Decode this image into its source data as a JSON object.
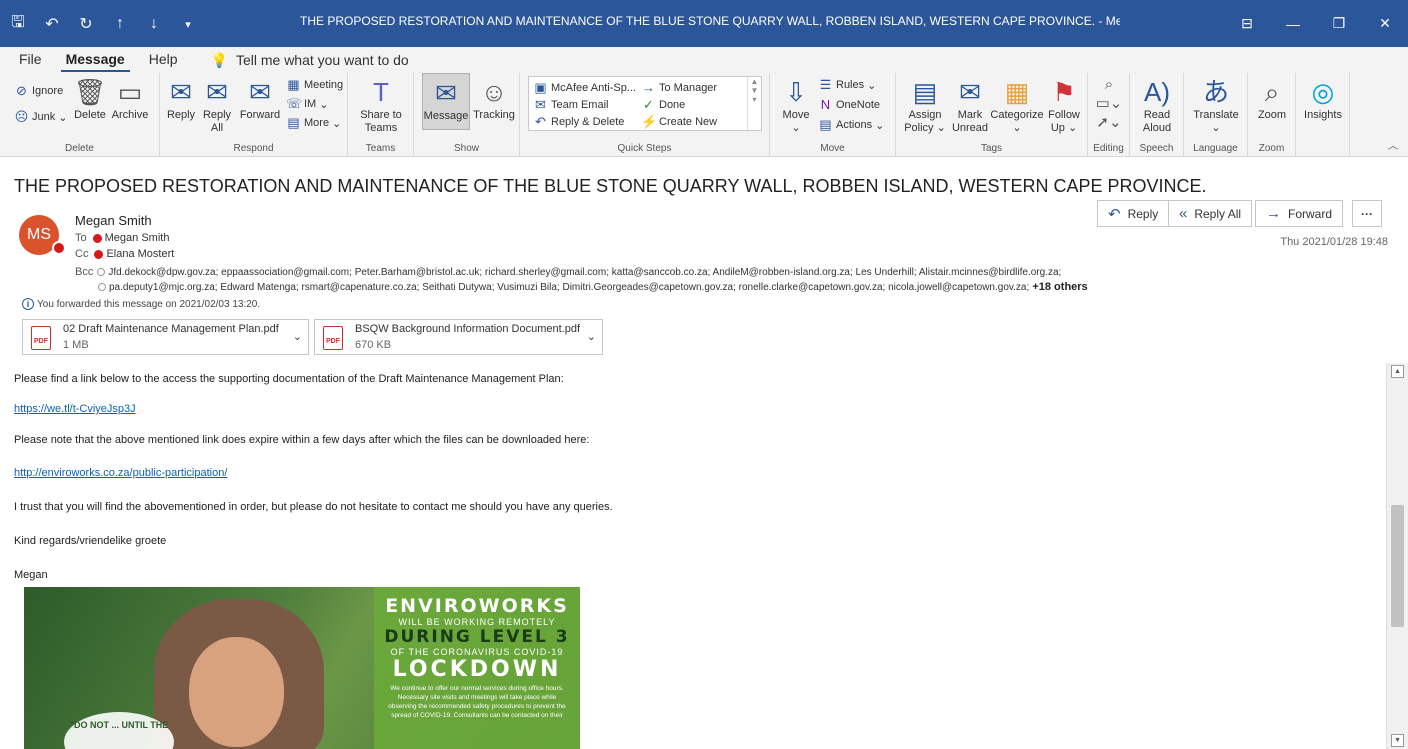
{
  "window": {
    "title": "THE PROPOSED RESTORATION AND MAINTENANCE OF THE BLUE STONE QUARRY WALL, ROBBEN ISLAND, WESTERN CAPE PROVINCE.  - Message (HTML)",
    "accent": "#2b579a"
  },
  "menu": {
    "items": [
      "File",
      "Message",
      "Help"
    ],
    "active": "Message",
    "search": "Tell me what you want to do"
  },
  "ribbon": {
    "delete": {
      "ignore": "Ignore",
      "junk": "Junk",
      "delete": "Delete",
      "archive": "Archive",
      "label": "Delete"
    },
    "respond": {
      "reply": "Reply",
      "reply_all_1": "Reply",
      "reply_all_2": "All",
      "forward": "Forward",
      "meeting": "Meeting",
      "im": "IM",
      "more": "More",
      "label": "Respond"
    },
    "teams": {
      "share_1": "Share to",
      "share_2": "Teams",
      "label": "Teams"
    },
    "show": {
      "message": "Message",
      "tracking": "Tracking",
      "label": "Show"
    },
    "quicksteps": {
      "mcafee": "McAfee Anti-Sp...",
      "team_email": "Team Email",
      "reply_delete": "Reply & Delete",
      "to_manager": "To Manager",
      "done": "Done",
      "create_new": "Create New",
      "label": "Quick Steps"
    },
    "move": {
      "move": "Move",
      "rules": "Rules",
      "onenote": "OneNote",
      "actions": "Actions",
      "label": "Move"
    },
    "tags": {
      "assign_1": "Assign",
      "assign_2": "Policy",
      "mark_1": "Mark",
      "mark_2": "Unread",
      "categorize": "Categorize",
      "follow_1": "Follow",
      "follow_2": "Up",
      "label": "Tags"
    },
    "editing": {
      "label": "Editing"
    },
    "speech": {
      "read_1": "Read",
      "read_2": "Aloud",
      "label": "Speech"
    },
    "language": {
      "translate": "Translate",
      "label": "Language"
    },
    "zoom": {
      "zoom": "Zoom",
      "label": "Zoom"
    },
    "insights": {
      "insights": "Insights"
    }
  },
  "message": {
    "subject": "THE PROPOSED RESTORATION AND MAINTENANCE OF THE BLUE STONE QUARRY WALL, ROBBEN ISLAND, WESTERN CAPE PROVINCE.",
    "sender_initials": "MS",
    "sender": "Megan Smith",
    "to_label": "To",
    "to": "Megan Smith",
    "cc_label": "Cc",
    "cc": "Elana Mostert",
    "bcc_label": "Bcc",
    "bcc_line1": "Jfd.dekock@dpw.gov.za;  eppaassociation@gmail.com;  Peter.Barham@bristol.ac.uk;  richard.sherley@gmail.com;  katta@sanccob.co.za;  AndileM@robben-island.org.za;  Les Underhill;  Alistair.mcinnes@birdlife.org.za;",
    "bcc_line2": "pa.deputy1@mjc.org.za;  Edward Matenga;  rsmart@capenature.co.za;  Seithati Dutywa;  Vusimuzi Bila;  Dimitri.Georgeades@capetown.gov.za;  ronelle.clarke@capetown.gov.za;  nicola.jowell@capetown.gov.za;",
    "bcc_more": "+18 others",
    "date": "Thu 2021/01/28 19:48",
    "forwarded": "You forwarded this message on 2021/02/03 13:20.",
    "actions": {
      "reply": "Reply",
      "reply_all": "Reply All",
      "forward": "Forward",
      "more": "···"
    },
    "attachments": [
      {
        "name": "02 Draft Maintenance Management Plan.pdf",
        "size": "1 MB"
      },
      {
        "name": "BSQW Background Information Document.pdf",
        "size": "670 KB"
      }
    ]
  },
  "body": {
    "p1": "Please find a link below to the access the supporting documentation of the Draft Maintenance Management Plan:",
    "link1": "https://we.tl/t-CviyeJsp3J",
    "p2": "Please note that the above mentioned link does expire within a few days after which the files can be downloaded here:",
    "link2": "http://enviroworks.co.za/public-participation/",
    "p3": "I trust that you will find the abovementioned in order, but please do not hesitate to contact me should you have any queries.",
    "p4": "Kind regards/vriendelike groete",
    "p5": "Megan"
  },
  "banner": {
    "t1": "ENVIROWORKS",
    "t2": "WILL BE WORKING REMOTELY",
    "t3": "DURING LEVEL 3",
    "t2b": "OF THE CORONAVIRUS COVID-19",
    "t4": "LOCKDOWN",
    "t5": "We continue to offer our normal services during office hours. Necessary site visits and meetings will take place while observing the recommended safety procedures to prevent the spread of COVID-19. Consultants can be contacted on their",
    "quote": "\"DO NOT ... UNTIL THE"
  }
}
